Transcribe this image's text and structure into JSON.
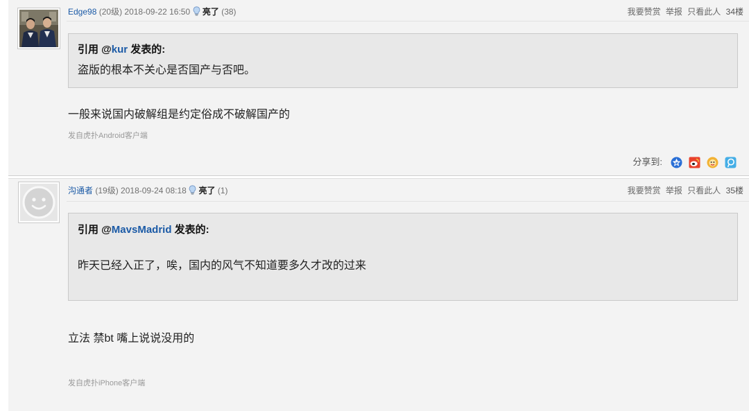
{
  "colors": {
    "link": "#1b5aa6",
    "text": "#333333",
    "muted": "#707070",
    "faint": "#999999",
    "post_background": "#f3f3f3",
    "quote_background": "#e8e8e8",
    "quote_border": "#c9c9c9"
  },
  "posts": [
    {
      "username": "Edge98",
      "level": "(20级)",
      "datetime": "2018-09-22 16:50",
      "light_icon": "lightbulb-icon",
      "light_label": "亮了",
      "light_count": "(38)",
      "actions": {
        "reward": "我要赞赏",
        "report": "举报",
        "only_author": "只看此人"
      },
      "floor": "34楼",
      "quote": {
        "lead": "引用 @",
        "author": "kur",
        "tail": " 发表的:",
        "text": "盗版的根本不关心是否国产与否吧。"
      },
      "reply": "一般来说国内破解组是约定俗成不破解国产的",
      "source": "发自虎扑Android客户端",
      "share": {
        "label": "分享到:",
        "icons": [
          "qzone-icon",
          "weibo-icon",
          "qq-icon",
          "tencent-weibo-icon"
        ]
      }
    },
    {
      "username": "沟通者",
      "level": "(19级)",
      "datetime": "2018-09-24 08:18",
      "light_icon": "lightbulb-icon",
      "light_label": "亮了",
      "light_count": "(1)",
      "actions": {
        "reward": "我要赞赏",
        "report": "举报",
        "only_author": "只看此人"
      },
      "floor": "35楼",
      "quote": {
        "lead": "引用 @",
        "author": "MavsMadrid",
        "tail": " 发表的:",
        "text": "昨天已经入正了，唉，国内的风气不知道要多久才改的过来"
      },
      "reply": "立法 禁bt 嘴上说说没用的",
      "source": "发自虎扑iPhone客户端"
    }
  ]
}
